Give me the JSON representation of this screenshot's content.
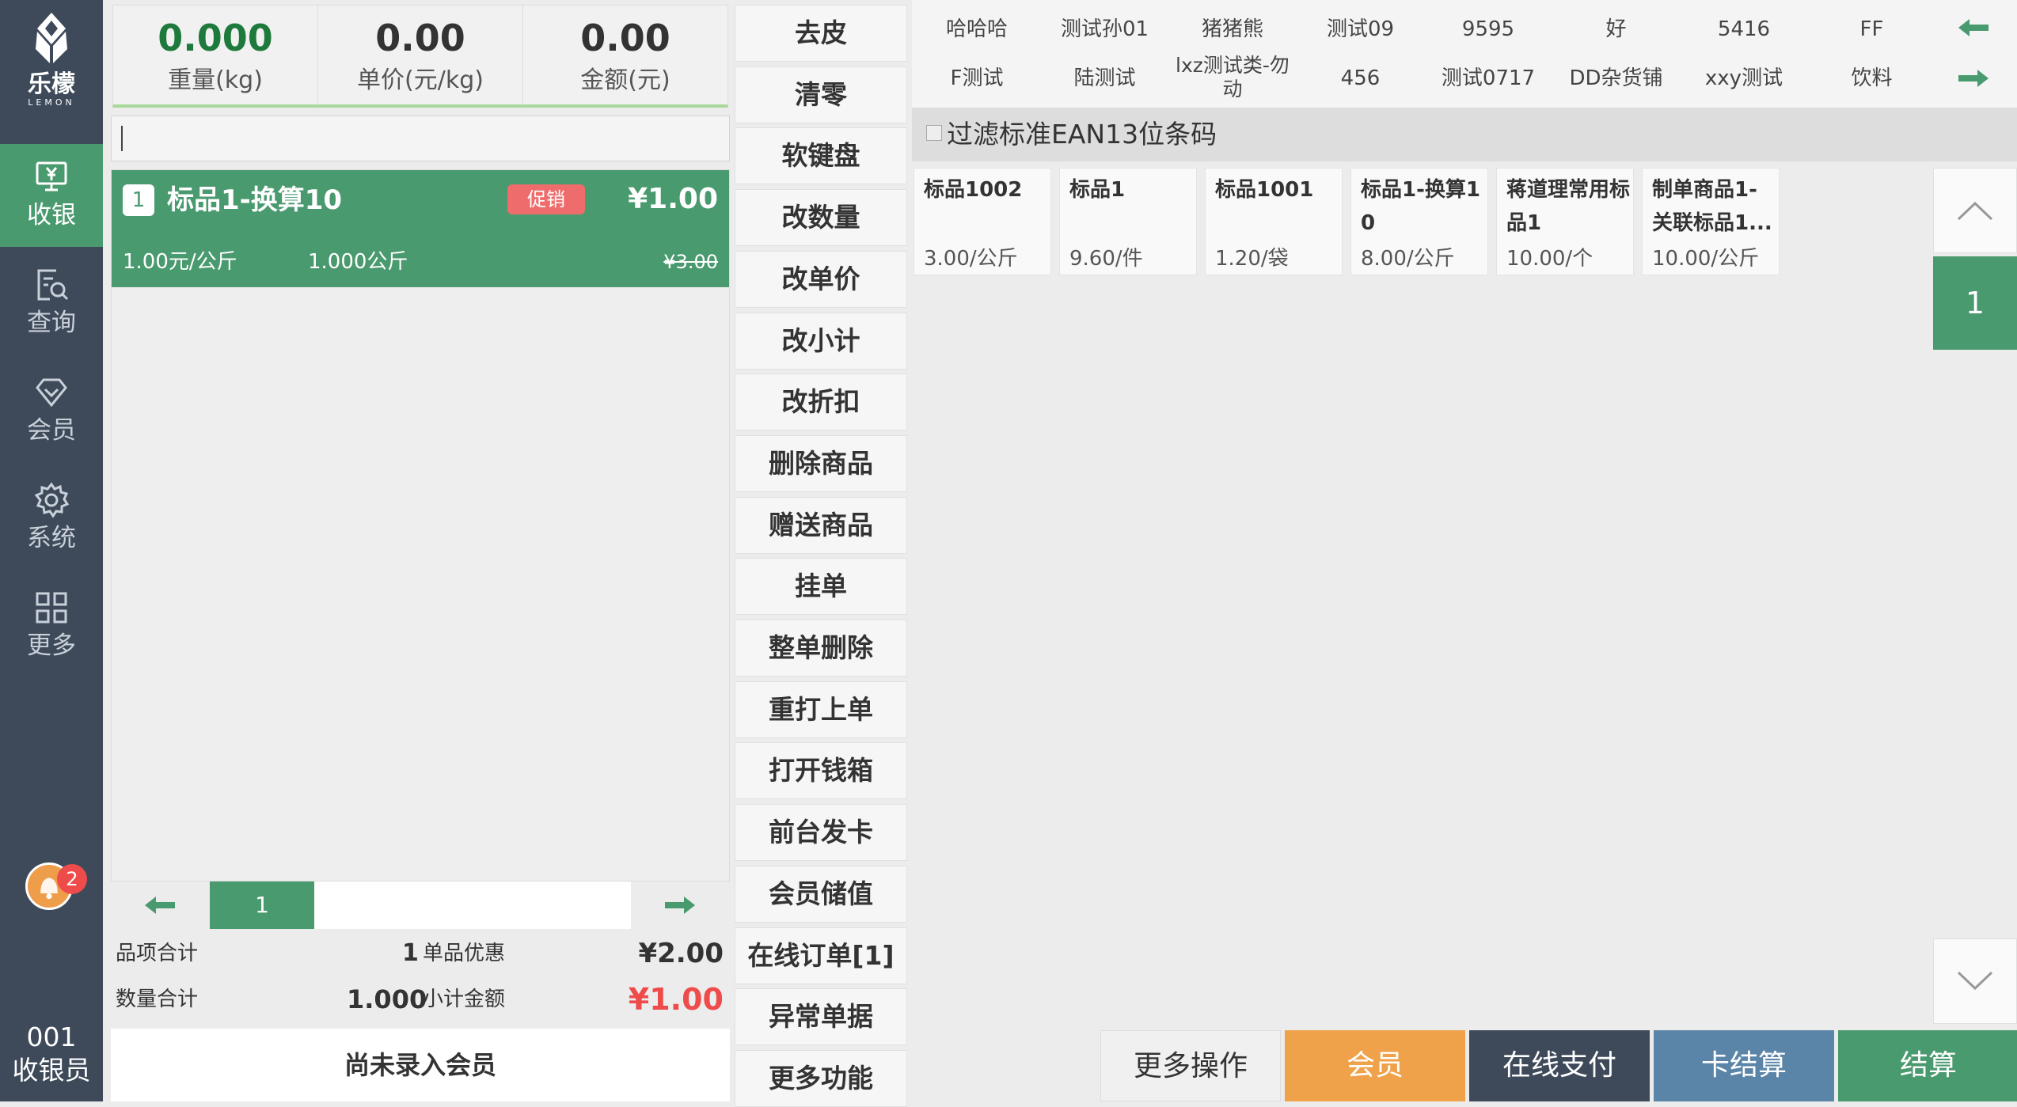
{
  "brand": {
    "name": "乐檬",
    "sub": "LEMON"
  },
  "nav": [
    {
      "label": "收银",
      "icon": "cashier-icon",
      "active": true
    },
    {
      "label": "查询",
      "icon": "query-icon",
      "active": false
    },
    {
      "label": "会员",
      "icon": "member-icon",
      "active": false
    },
    {
      "label": "系统",
      "icon": "settings-icon",
      "active": false
    },
    {
      "label": "更多",
      "icon": "grid-icon",
      "active": false
    }
  ],
  "notification": {
    "count": "2"
  },
  "operator": {
    "id": "001",
    "role": "收银员"
  },
  "scale": {
    "weight": "0.000",
    "weight_label": "重量(kg)",
    "unit_price": "0.00",
    "unit_price_label": "单价(元/kg)",
    "amount": "0.00",
    "amount_label": "金额(元)"
  },
  "cart": {
    "items": [
      {
        "index": "1",
        "name": "标品1-换算10",
        "promo": "促销",
        "price": "¥1.00",
        "unit_price": "1.00元/公斤",
        "qty": "1.000公斤",
        "orig_price": "¥3.00"
      }
    ],
    "page": "1"
  },
  "totals": {
    "item_label": "品项合计",
    "item_count": "1",
    "discount_label": "单品优惠",
    "discount": "¥2.00",
    "qty_label": "数量合计",
    "qty": "1.000",
    "subtotal_label": "小计金额",
    "subtotal": "¥1.00"
  },
  "member": {
    "status": "尚未录入会员"
  },
  "functions": [
    "去皮",
    "清零",
    "软键盘",
    "改数量",
    "改单价",
    "改小计",
    "改折扣",
    "删除商品",
    "赠送商品",
    "挂单",
    "整单删除",
    "重打上单",
    "打开钱箱",
    "前台发卡",
    "会员储值",
    "在线订单[1]",
    "异常单据",
    "更多功能"
  ],
  "categories": {
    "row1": [
      "哈哈哈",
      "测试孙01",
      "猪猪熊",
      "测试09",
      "9595",
      "好",
      "5416",
      "FF"
    ],
    "row2": [
      "F测试",
      "陆测试",
      "lxz测试类-勿动",
      "456",
      "测试0717",
      "DD杂货铺",
      "xxy测试",
      "饮料"
    ]
  },
  "filter": {
    "label": "过滤标准EAN13位条码"
  },
  "products": [
    {
      "name": "标品1002",
      "price": "3.00/公斤"
    },
    {
      "name": "标品1",
      "price": "9.60/件"
    },
    {
      "name": "标品1001",
      "price": "1.20/袋"
    },
    {
      "name": "标品1-换算10",
      "price": "8.00/公斤"
    },
    {
      "name": "蒋道理常用标品1",
      "price": "10.00/个"
    },
    {
      "name": "制单商品1-关联标品1...",
      "price": "10.00/公斤"
    }
  ],
  "product_page": "1",
  "actions": [
    {
      "label": "更多操作",
      "color": "#f0f0f0"
    },
    {
      "label": "会员",
      "color": "#f0a24a"
    },
    {
      "label": "在线支付",
      "color": "#3e4a5a"
    },
    {
      "label": "卡结算",
      "color": "#5b85a8"
    },
    {
      "label": "结算",
      "color": "#4a9a6f"
    }
  ],
  "colors": {
    "accent": "#4a9a6f",
    "sidebar": "#3e4a5a",
    "warning": "#f0a24a",
    "danger": "#ee4b4b"
  }
}
